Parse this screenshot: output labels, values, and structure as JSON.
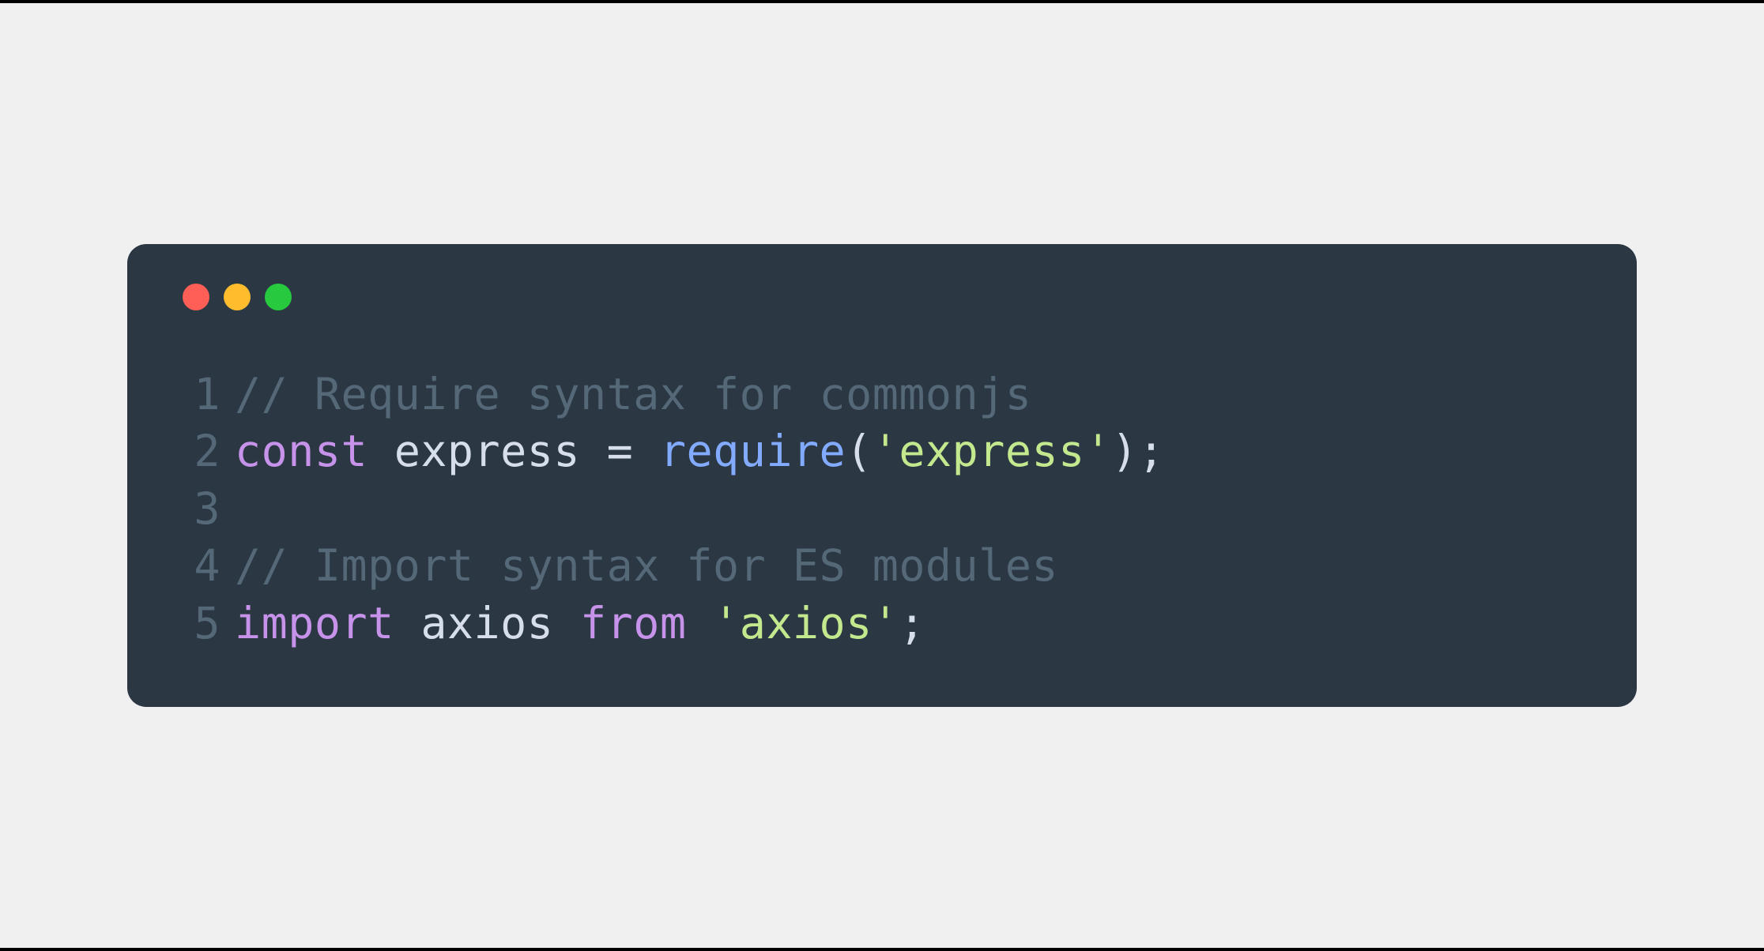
{
  "code": {
    "lines": [
      {
        "number": "1",
        "tokens": [
          {
            "type": "comment",
            "text": "// Require syntax for commonjs"
          }
        ]
      },
      {
        "number": "2",
        "tokens": [
          {
            "type": "keyword",
            "text": "const"
          },
          {
            "type": "space",
            "text": " "
          },
          {
            "type": "variable",
            "text": "express"
          },
          {
            "type": "space",
            "text": " "
          },
          {
            "type": "operator",
            "text": "="
          },
          {
            "type": "space",
            "text": " "
          },
          {
            "type": "function",
            "text": "require"
          },
          {
            "type": "punctuation",
            "text": "("
          },
          {
            "type": "string",
            "text": "'express'"
          },
          {
            "type": "punctuation",
            "text": ")"
          },
          {
            "type": "punctuation",
            "text": ";"
          }
        ]
      },
      {
        "number": "3",
        "tokens": []
      },
      {
        "number": "4",
        "tokens": [
          {
            "type": "comment",
            "text": "// Import syntax for ES modules"
          }
        ]
      },
      {
        "number": "5",
        "tokens": [
          {
            "type": "keyword",
            "text": "import"
          },
          {
            "type": "space",
            "text": " "
          },
          {
            "type": "variable",
            "text": "axios"
          },
          {
            "type": "space",
            "text": " "
          },
          {
            "type": "keyword",
            "text": "from"
          },
          {
            "type": "space",
            "text": " "
          },
          {
            "type": "string",
            "text": "'axios'"
          },
          {
            "type": "punctuation",
            "text": ";"
          }
        ]
      }
    ]
  },
  "colors": {
    "window_bg": "#2b3844",
    "page_bg": "#f0f0f0",
    "red_light": "#ff5f56",
    "yellow_light": "#ffbd2e",
    "green_light": "#27c93f",
    "comment": "#546878",
    "keyword": "#c792ea",
    "variable": "#d6deeb",
    "function": "#82aaff",
    "string": "#c3e88d"
  }
}
